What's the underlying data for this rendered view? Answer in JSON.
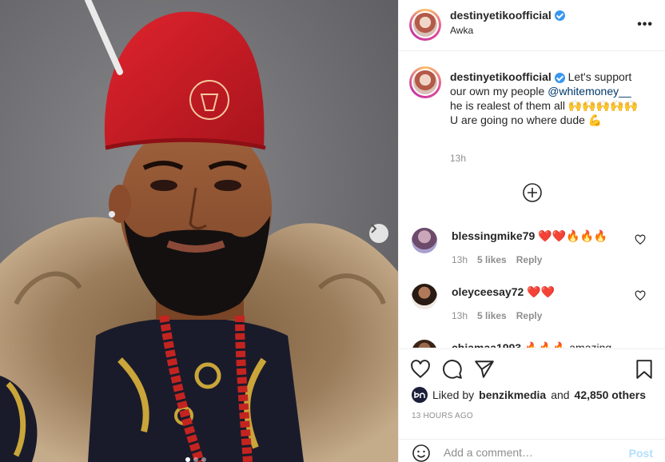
{
  "post": {
    "username": "destinyetikoofficial",
    "location": "Awka",
    "more_label": "•••",
    "verified": true
  },
  "caption": {
    "username": "destinyetikoofficial",
    "text_before": "Let's support our own my people ",
    "mention": "@whitemoney__",
    "text_line2": " he is realest of them all 🙌🙌🙌🙌🙌",
    "text_line3": "U are going no where dude 💪",
    "time": "13h"
  },
  "comments": [
    {
      "username": "blessingmike79",
      "text": "❤️❤️🔥🔥🔥",
      "time": "13h",
      "likes": "5 likes",
      "reply": "Reply"
    },
    {
      "username": "oleyceesay72",
      "text": "❤️❤️",
      "time": "13h",
      "likes": "5 likes",
      "reply": "Reply"
    },
    {
      "username": "chiamaa1993",
      "text": "🔥🔥🔥 amazing",
      "time": "",
      "likes": "",
      "reply": ""
    }
  ],
  "likes": {
    "prefix": "Liked by",
    "user": "benzikmedia",
    "middle": "and",
    "others": "42,850 others"
  },
  "post_age": "13 HOURS AGO",
  "comment_box": {
    "placeholder": "Add a comment…",
    "post_label": "Post"
  },
  "colors": {
    "accent_blue": "#0095f6",
    "post_disabled": "#b2dffc",
    "verified_blue": "#3897f0",
    "border": "#efefef"
  },
  "icons": [
    "heart-icon",
    "comment-icon",
    "share-icon",
    "bookmark-icon",
    "emoji-icon",
    "plus-circle-icon",
    "chevron-right-icon",
    "more-icon",
    "verified-icon"
  ],
  "carousel": {
    "slides": 3,
    "active": 1
  }
}
